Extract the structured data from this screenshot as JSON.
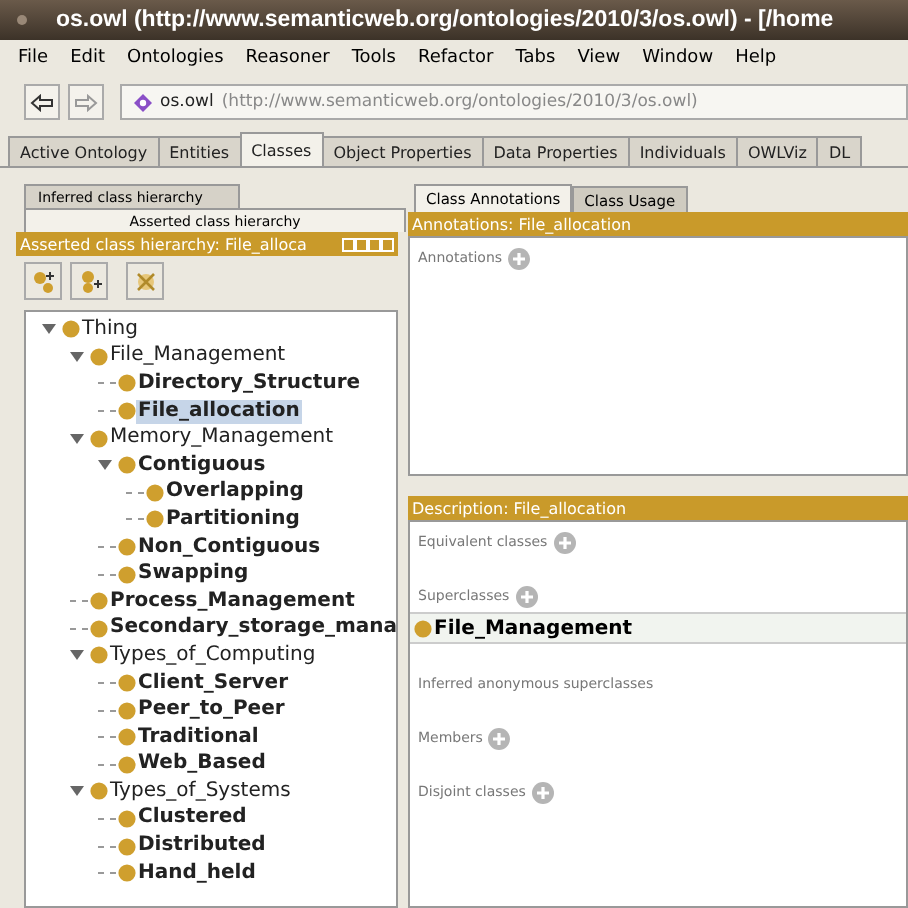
{
  "window": {
    "title": "os.owl (http://www.semanticweb.org/ontologies/2010/3/os.owl) - [/home"
  },
  "menu": [
    "File",
    "Edit",
    "Ontologies",
    "Reasoner",
    "Tools",
    "Refactor",
    "Tabs",
    "View",
    "Window",
    "Help"
  ],
  "address": {
    "name": "os.owl",
    "uri": "(http://www.semanticweb.org/ontologies/2010/3/os.owl)"
  },
  "tabs": [
    {
      "label": "Active Ontology",
      "selected": false
    },
    {
      "label": "Entities",
      "selected": false
    },
    {
      "label": "Classes",
      "selected": true
    },
    {
      "label": "Object Properties",
      "selected": false
    },
    {
      "label": "Data Properties",
      "selected": false
    },
    {
      "label": "Individuals",
      "selected": false
    },
    {
      "label": "OWLViz",
      "selected": false
    },
    {
      "label": "DL",
      "selected": false
    }
  ],
  "left": {
    "tabs": [
      {
        "label": "Inferred class hierarchy",
        "selected": false
      },
      {
        "label": "Asserted class hierarchy",
        "selected": true
      }
    ],
    "header": "Asserted class hierarchy: File_alloca",
    "tree": [
      {
        "label": "Thing",
        "bold": false,
        "selected": false,
        "expanded": true,
        "children": [
          {
            "label": "File_Management",
            "bold": false,
            "selected": false,
            "expanded": true,
            "children": [
              {
                "label": "Directory_Structure",
                "bold": true,
                "selected": false
              },
              {
                "label": "File_allocation",
                "bold": true,
                "selected": true
              }
            ]
          },
          {
            "label": "Memory_Management",
            "bold": false,
            "selected": false,
            "expanded": true,
            "children": [
              {
                "label": "Contiguous",
                "bold": true,
                "selected": false,
                "expanded": true,
                "children": [
                  {
                    "label": "Overlapping",
                    "bold": true,
                    "selected": false
                  },
                  {
                    "label": "Partitioning",
                    "bold": true,
                    "selected": false
                  }
                ]
              },
              {
                "label": "Non_Contiguous",
                "bold": true,
                "selected": false
              },
              {
                "label": "Swapping",
                "bold": true,
                "selected": false
              }
            ]
          },
          {
            "label": "Process_Management",
            "bold": true,
            "selected": false
          },
          {
            "label": "Secondary_storage_mana",
            "bold": true,
            "selected": false
          },
          {
            "label": "Types_of_Computing",
            "bold": false,
            "selected": false,
            "expanded": true,
            "children": [
              {
                "label": "Client_Server",
                "bold": true,
                "selected": false
              },
              {
                "label": "Peer_to_Peer",
                "bold": true,
                "selected": false
              },
              {
                "label": "Traditional",
                "bold": true,
                "selected": false
              },
              {
                "label": "Web_Based",
                "bold": true,
                "selected": false
              }
            ]
          },
          {
            "label": "Types_of_Systems",
            "bold": false,
            "selected": false,
            "expanded": true,
            "children": [
              {
                "label": "Clustered",
                "bold": true,
                "selected": false
              },
              {
                "label": "Distributed",
                "bold": true,
                "selected": false
              },
              {
                "label": "Hand_held",
                "bold": true,
                "selected": false
              }
            ]
          }
        ]
      }
    ]
  },
  "right": {
    "tabs": [
      {
        "label": "Class Annotations",
        "selected": true
      },
      {
        "label": "Class Usage",
        "selected": false
      }
    ],
    "annotations_header": "Annotations: File_allocation",
    "annotations_label": "Annotations",
    "description_header": "Description: File_allocation",
    "sections": [
      {
        "label": "Equivalent classes",
        "addable": true
      },
      {
        "label": "Superclasses",
        "addable": true,
        "items": [
          "File_Management"
        ]
      },
      {
        "label": "Inferred anonymous superclasses",
        "addable": false
      },
      {
        "label": "Members",
        "addable": true
      },
      {
        "label": "Disjoint classes",
        "addable": true
      }
    ]
  }
}
